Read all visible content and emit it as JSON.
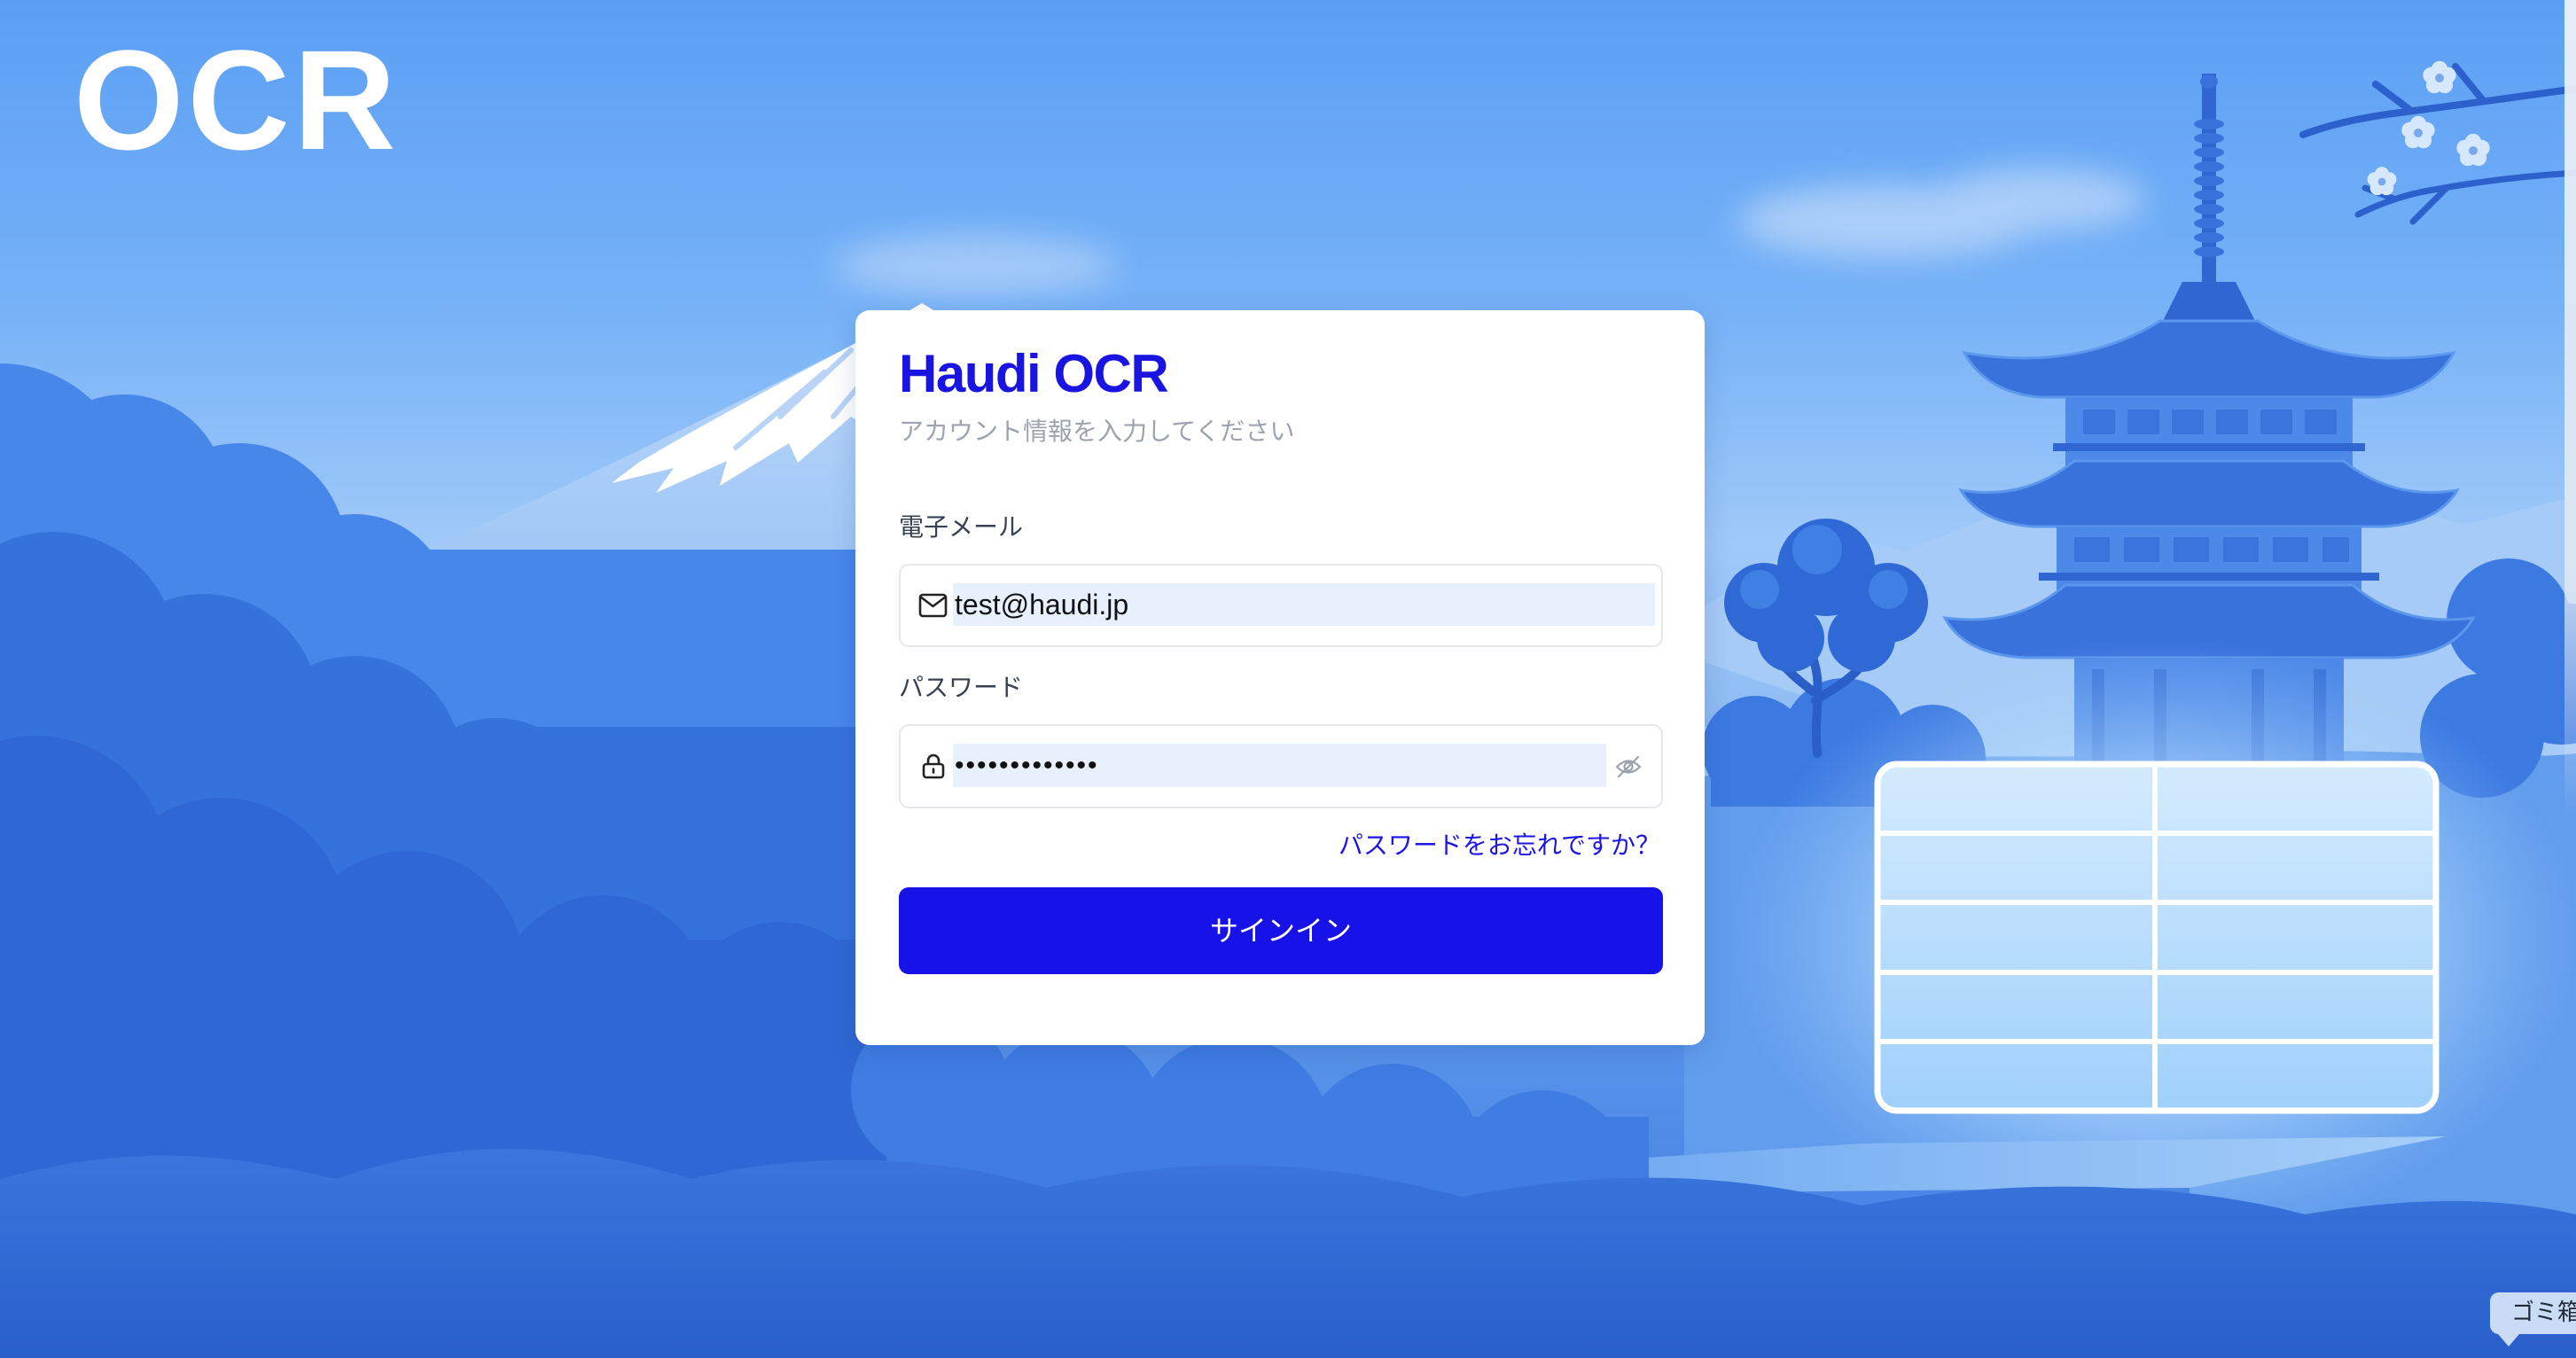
{
  "app": {
    "logo": "OCR"
  },
  "login": {
    "title": "Haudi OCR",
    "subtitle": "アカウント情報を入力してください",
    "email": {
      "label": "電子メール",
      "value": "test@haudi.jp",
      "icon": "mail-icon"
    },
    "password": {
      "label": "パスワード",
      "value": "•••••••••••••",
      "icon": "lock-icon",
      "toggle_icon": "eye-off-icon"
    },
    "forgot_password": "パスワードをお忘れですか？",
    "submit": "サインイン"
  },
  "dock_tooltip": {
    "text": "ゴミ箱"
  },
  "colors": {
    "accent": "#1712e8",
    "title": "#1a14e3",
    "subtitle": "#9ca3af",
    "label": "#374151",
    "autofill_background": "#e8f0fe",
    "card_background": "#ffffff",
    "sky": "#5b9ff4"
  }
}
